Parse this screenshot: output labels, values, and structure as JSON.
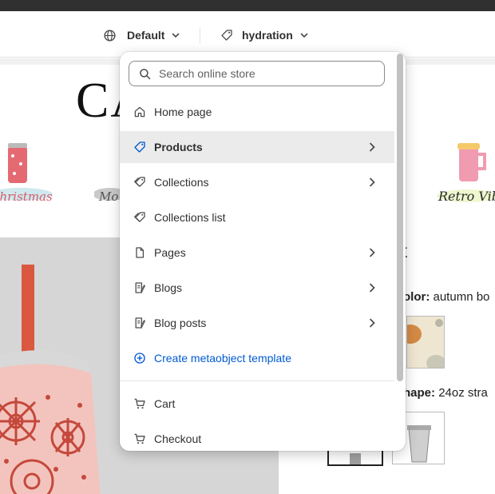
{
  "editor_bar": {
    "market_label": "Default",
    "template_label": "hydration"
  },
  "store_preview": {
    "title": "CA",
    "collections": [
      "Christmas",
      "Mo",
      "Retro Vibes"
    ],
    "product_title": "st",
    "color_option": {
      "label": "olor:",
      "value": "autumn bo"
    },
    "shape_option": {
      "label": "hape:",
      "value": "24oz stra"
    }
  },
  "dropdown": {
    "search_placeholder": "Search online store",
    "items": [
      {
        "label": "Home page",
        "icon": "home-icon",
        "has_submenu": false
      },
      {
        "label": "Products",
        "icon": "tag-icon",
        "has_submenu": true,
        "active": true
      },
      {
        "label": "Collections",
        "icon": "tags-icon",
        "has_submenu": true
      },
      {
        "label": "Collections list",
        "icon": "tags-icon",
        "has_submenu": false
      },
      {
        "label": "Pages",
        "icon": "page-icon",
        "has_submenu": true
      },
      {
        "label": "Blogs",
        "icon": "blog-icon",
        "has_submenu": true
      },
      {
        "label": "Blog posts",
        "icon": "blog-icon",
        "has_submenu": true
      },
      {
        "label": "Create metaobject template",
        "icon": "plus-circle-icon",
        "has_submenu": false,
        "link": true
      },
      {
        "label": "Cart",
        "icon": "cart-icon",
        "has_submenu": false
      },
      {
        "label": "Checkout",
        "icon": "cart-icon",
        "has_submenu": false
      }
    ]
  },
  "colors": {
    "top_strip": "#303030",
    "link_blue": "#005bd3",
    "active_row": "#ebebeb"
  }
}
